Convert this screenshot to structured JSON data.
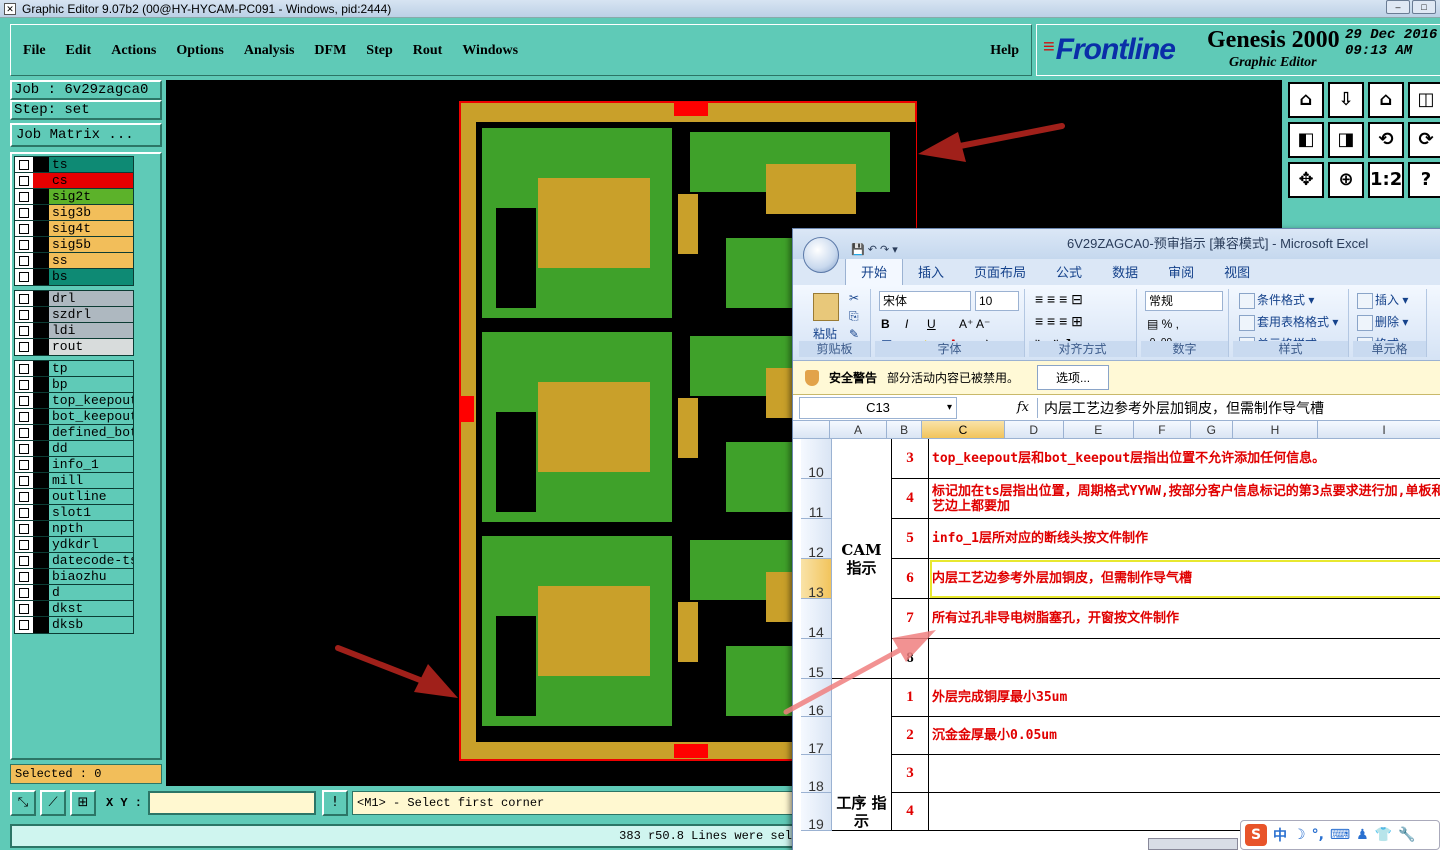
{
  "window": {
    "title": "Graphic Editor 9.07b2 (00@HY-HYCAM-PC091 - Windows, pid:2444)"
  },
  "menu": [
    "File",
    "Edit",
    "Actions",
    "Options",
    "Analysis",
    "DFM",
    "Step",
    "Rout",
    "Windows"
  ],
  "help": "Help",
  "brand": {
    "logo": "Frontline",
    "product": "Genesis 2000",
    "subtitle": "Graphic Editor",
    "date": "29 Dec 2016",
    "time": "09:13 AM"
  },
  "job": {
    "job_label": "Job : 6v29zagca0",
    "step_label": "Step: set",
    "matrix_button": "Job Matrix ..."
  },
  "layer_groups": [
    [
      {
        "name": "ts",
        "color": "#0e8a74"
      },
      {
        "name": "cs",
        "color": "#e60000",
        "sel": true
      },
      {
        "name": "sig2t",
        "color": "#5cb22a"
      },
      {
        "name": "sig3b",
        "color": "#f2be5a"
      },
      {
        "name": "sig4t",
        "color": "#f2be5a"
      },
      {
        "name": "sig5b",
        "color": "#f2be5a"
      },
      {
        "name": "ss",
        "color": "#f2be5a"
      },
      {
        "name": "bs",
        "color": "#0e8a74"
      }
    ],
    [
      {
        "name": "drl",
        "color": "#aeb8c0"
      },
      {
        "name": "szdrl",
        "color": "#aeb8c0"
      },
      {
        "name": "ldi",
        "color": "#aeb8c0"
      },
      {
        "name": "rout",
        "color": "#d8dcdc"
      }
    ],
    [
      {
        "name": "tp",
        "color": "#5fcab7"
      },
      {
        "name": "bp",
        "color": "#5fcab7"
      },
      {
        "name": "top_keepout",
        "color": "#5fcab7"
      },
      {
        "name": "bot_keepout",
        "color": "#5fcab7"
      },
      {
        "name": "defined_bot",
        "color": "#5fcab7"
      },
      {
        "name": "dd",
        "color": "#5fcab7"
      },
      {
        "name": "info_1",
        "color": "#5fcab7"
      },
      {
        "name": "mill",
        "color": "#5fcab7"
      },
      {
        "name": "outline",
        "color": "#5fcab7"
      },
      {
        "name": "slot1",
        "color": "#5fcab7"
      },
      {
        "name": "npth",
        "color": "#5fcab7"
      },
      {
        "name": "ydkdrl",
        "color": "#5fcab7"
      },
      {
        "name": "datecode-ts",
        "color": "#5fcab7"
      },
      {
        "name": "biaozhu",
        "color": "#5fcab7"
      },
      {
        "name": "d",
        "color": "#5fcab7"
      },
      {
        "name": "dkst",
        "color": "#5fcab7"
      },
      {
        "name": "dksb",
        "color": "#5fcab7"
      }
    ]
  ],
  "selected": "Selected : 0",
  "xy_label": "X Y :",
  "prompt": "<M1> - Select first corner",
  "status": "383 r50.8 Lines were sel",
  "toolbox": [
    "⌂",
    "⇩",
    "⌂",
    "◫",
    "◧",
    "◨",
    "⟲",
    "⟳",
    "✥",
    "⊕",
    "1:2",
    "?"
  ],
  "excel": {
    "title": "6V29ZAGCA0-预审指示 [兼容模式] - Microsoft Excel",
    "tabs": [
      "开始",
      "插入",
      "页面布局",
      "公式",
      "数据",
      "审阅",
      "视图"
    ],
    "ribbon": {
      "paste": "粘贴",
      "clipboard": "剪贴板",
      "font_name": "宋体",
      "font_size": "10",
      "font": "字体",
      "align": "对齐方式",
      "number_format": "常规",
      "number": "数字",
      "styles": "样式",
      "cond_fmt": "条件格式",
      "table_fmt": "套用表格格式",
      "cell_style": "单元格样式",
      "insert": "插入",
      "delete": "删除",
      "format": "格式",
      "cells": "单元格"
    },
    "security": {
      "label": "安全警告",
      "message": "部分活动内容已被禁用。",
      "button": "选项..."
    },
    "name_box": "C13",
    "fx": "fx",
    "formula": "内层工艺边参考外层加铜皮，但需制作导气槽",
    "columns": [
      "A",
      "B",
      "C",
      "D",
      "E",
      "F",
      "G",
      "H",
      "I"
    ],
    "rows": [
      {
        "row": "10",
        "num": "3",
        "text": "top_keepout层和bot_keepout层指出位置不允许添加任何信息。"
      },
      {
        "row": "11",
        "num": "4",
        "text": "标记加在ts层指出位置，周期格式YYWW,按部分客户信息标记的第3点要求进行加,单板和工艺边上都要加"
      },
      {
        "row": "12",
        "num": "5",
        "text": "info_1层所对应的断线头按文件制作"
      },
      {
        "row": "13",
        "num": "6",
        "text": "内层工艺边参考外层加铜皮，但需制作导气槽"
      },
      {
        "row": "14",
        "num": "7",
        "text": "所有过孔非导电树脂塞孔，开窗按文件制作"
      },
      {
        "row": "15",
        "num": "8",
        "text": ""
      },
      {
        "row": "16",
        "num": "1",
        "text": "外层完成铜厚最小35um"
      },
      {
        "row": "17",
        "num": "2",
        "text": "沉金金厚最小0.05um"
      },
      {
        "row": "18",
        "num": "3",
        "text": ""
      },
      {
        "row": "19",
        "num": "4",
        "text": ""
      }
    ],
    "group1": "CAM 指示",
    "group2": "工序 指示"
  },
  "ime": {
    "label": "中"
  }
}
